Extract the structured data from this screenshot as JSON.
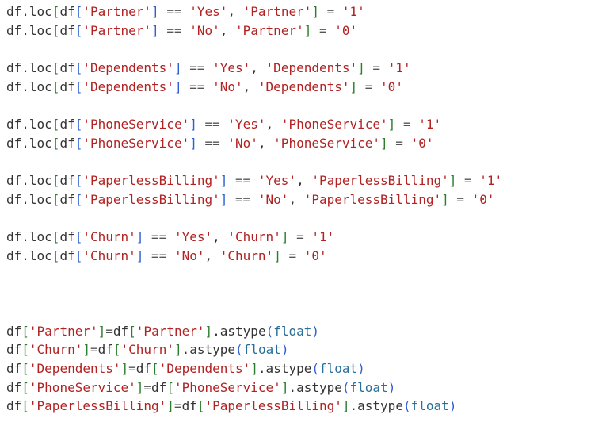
{
  "code": {
    "lines": [
      [
        {
          "t": "df.loc",
          "c": "plain"
        },
        {
          "t": "[",
          "c": "br1"
        },
        {
          "t": "df",
          "c": "plain"
        },
        {
          "t": "[",
          "c": "br2"
        },
        {
          "t": "'Partner'",
          "c": "str"
        },
        {
          "t": "]",
          "c": "br2"
        },
        {
          "t": " == ",
          "c": "op"
        },
        {
          "t": "'Yes'",
          "c": "str"
        },
        {
          "t": ", ",
          "c": "plain"
        },
        {
          "t": "'Partner'",
          "c": "str"
        },
        {
          "t": "]",
          "c": "br1"
        },
        {
          "t": " = ",
          "c": "op"
        },
        {
          "t": "'1'",
          "c": "str"
        }
      ],
      [
        {
          "t": "df.loc",
          "c": "plain"
        },
        {
          "t": "[",
          "c": "br1"
        },
        {
          "t": "df",
          "c": "plain"
        },
        {
          "t": "[",
          "c": "br2"
        },
        {
          "t": "'Partner'",
          "c": "str"
        },
        {
          "t": "]",
          "c": "br2"
        },
        {
          "t": " == ",
          "c": "op"
        },
        {
          "t": "'No'",
          "c": "str"
        },
        {
          "t": ", ",
          "c": "plain"
        },
        {
          "t": "'Partner'",
          "c": "str"
        },
        {
          "t": "]",
          "c": "br1"
        },
        {
          "t": " = ",
          "c": "op"
        },
        {
          "t": "'0'",
          "c": "str"
        }
      ],
      [],
      [
        {
          "t": "df.loc",
          "c": "plain"
        },
        {
          "t": "[",
          "c": "br1"
        },
        {
          "t": "df",
          "c": "plain"
        },
        {
          "t": "[",
          "c": "br2"
        },
        {
          "t": "'Dependents'",
          "c": "str"
        },
        {
          "t": "]",
          "c": "br2"
        },
        {
          "t": " == ",
          "c": "op"
        },
        {
          "t": "'Yes'",
          "c": "str"
        },
        {
          "t": ", ",
          "c": "plain"
        },
        {
          "t": "'Dependents'",
          "c": "str"
        },
        {
          "t": "]",
          "c": "br1"
        },
        {
          "t": " = ",
          "c": "op"
        },
        {
          "t": "'1'",
          "c": "str"
        }
      ],
      [
        {
          "t": "df.loc",
          "c": "plain"
        },
        {
          "t": "[",
          "c": "br1"
        },
        {
          "t": "df",
          "c": "plain"
        },
        {
          "t": "[",
          "c": "br2"
        },
        {
          "t": "'Dependents'",
          "c": "str"
        },
        {
          "t": "]",
          "c": "br2"
        },
        {
          "t": " == ",
          "c": "op"
        },
        {
          "t": "'No'",
          "c": "str"
        },
        {
          "t": ", ",
          "c": "plain"
        },
        {
          "t": "'Dependents'",
          "c": "str"
        },
        {
          "t": "]",
          "c": "br1"
        },
        {
          "t": " = ",
          "c": "op"
        },
        {
          "t": "'0'",
          "c": "str"
        }
      ],
      [],
      [
        {
          "t": "df.loc",
          "c": "plain"
        },
        {
          "t": "[",
          "c": "br1"
        },
        {
          "t": "df",
          "c": "plain"
        },
        {
          "t": "[",
          "c": "br2"
        },
        {
          "t": "'PhoneService'",
          "c": "str"
        },
        {
          "t": "]",
          "c": "br2"
        },
        {
          "t": " == ",
          "c": "op"
        },
        {
          "t": "'Yes'",
          "c": "str"
        },
        {
          "t": ", ",
          "c": "plain"
        },
        {
          "t": "'PhoneService'",
          "c": "str"
        },
        {
          "t": "]",
          "c": "br1"
        },
        {
          "t": " = ",
          "c": "op"
        },
        {
          "t": "'1'",
          "c": "str"
        }
      ],
      [
        {
          "t": "df.loc",
          "c": "plain"
        },
        {
          "t": "[",
          "c": "br1"
        },
        {
          "t": "df",
          "c": "plain"
        },
        {
          "t": "[",
          "c": "br2"
        },
        {
          "t": "'PhoneService'",
          "c": "str"
        },
        {
          "t": "]",
          "c": "br2"
        },
        {
          "t": " == ",
          "c": "op"
        },
        {
          "t": "'No'",
          "c": "str"
        },
        {
          "t": ", ",
          "c": "plain"
        },
        {
          "t": "'PhoneService'",
          "c": "str"
        },
        {
          "t": "]",
          "c": "br1"
        },
        {
          "t": " = ",
          "c": "op"
        },
        {
          "t": "'0'",
          "c": "str"
        }
      ],
      [],
      [
        {
          "t": "df.loc",
          "c": "plain"
        },
        {
          "t": "[",
          "c": "br1"
        },
        {
          "t": "df",
          "c": "plain"
        },
        {
          "t": "[",
          "c": "br2"
        },
        {
          "t": "'PaperlessBilling'",
          "c": "str"
        },
        {
          "t": "]",
          "c": "br2"
        },
        {
          "t": " == ",
          "c": "op"
        },
        {
          "t": "'Yes'",
          "c": "str"
        },
        {
          "t": ", ",
          "c": "plain"
        },
        {
          "t": "'PaperlessBilling'",
          "c": "str"
        },
        {
          "t": "]",
          "c": "br1"
        },
        {
          "t": " = ",
          "c": "op"
        },
        {
          "t": "'1'",
          "c": "str"
        }
      ],
      [
        {
          "t": "df.loc",
          "c": "plain"
        },
        {
          "t": "[",
          "c": "br1"
        },
        {
          "t": "df",
          "c": "plain"
        },
        {
          "t": "[",
          "c": "br2"
        },
        {
          "t": "'PaperlessBilling'",
          "c": "str"
        },
        {
          "t": "]",
          "c": "br2"
        },
        {
          "t": " == ",
          "c": "op"
        },
        {
          "t": "'No'",
          "c": "str"
        },
        {
          "t": ", ",
          "c": "plain"
        },
        {
          "t": "'PaperlessBilling'",
          "c": "str"
        },
        {
          "t": "]",
          "c": "br1"
        },
        {
          "t": " = ",
          "c": "op"
        },
        {
          "t": "'0'",
          "c": "str"
        }
      ],
      [],
      [
        {
          "t": "df.loc",
          "c": "plain"
        },
        {
          "t": "[",
          "c": "br1"
        },
        {
          "t": "df",
          "c": "plain"
        },
        {
          "t": "[",
          "c": "br2"
        },
        {
          "t": "'Churn'",
          "c": "str"
        },
        {
          "t": "]",
          "c": "br2"
        },
        {
          "t": " == ",
          "c": "op"
        },
        {
          "t": "'Yes'",
          "c": "str"
        },
        {
          "t": ", ",
          "c": "plain"
        },
        {
          "t": "'Churn'",
          "c": "str"
        },
        {
          "t": "]",
          "c": "br1"
        },
        {
          "t": " = ",
          "c": "op"
        },
        {
          "t": "'1'",
          "c": "str"
        }
      ],
      [
        {
          "t": "df.loc",
          "c": "plain"
        },
        {
          "t": "[",
          "c": "br1"
        },
        {
          "t": "df",
          "c": "plain"
        },
        {
          "t": "[",
          "c": "br2"
        },
        {
          "t": "'Churn'",
          "c": "str"
        },
        {
          "t": "]",
          "c": "br2"
        },
        {
          "t": " == ",
          "c": "op"
        },
        {
          "t": "'No'",
          "c": "str"
        },
        {
          "t": ", ",
          "c": "plain"
        },
        {
          "t": "'Churn'",
          "c": "str"
        },
        {
          "t": "]",
          "c": "br1"
        },
        {
          "t": " = ",
          "c": "op"
        },
        {
          "t": "'0'",
          "c": "str"
        }
      ],
      [],
      [],
      [],
      [
        {
          "t": "df",
          "c": "plain"
        },
        {
          "t": "[",
          "c": "br1"
        },
        {
          "t": "'Partner'",
          "c": "str"
        },
        {
          "t": "]",
          "c": "br1"
        },
        {
          "t": "=",
          "c": "op"
        },
        {
          "t": "df",
          "c": "plain"
        },
        {
          "t": "[",
          "c": "br1"
        },
        {
          "t": "'Partner'",
          "c": "str"
        },
        {
          "t": "]",
          "c": "br1"
        },
        {
          "t": ".astype",
          "c": "plain"
        },
        {
          "t": "(",
          "c": "br2"
        },
        {
          "t": "float",
          "c": "kw"
        },
        {
          "t": ")",
          "c": "br2"
        }
      ],
      [
        {
          "t": "df",
          "c": "plain"
        },
        {
          "t": "[",
          "c": "br1"
        },
        {
          "t": "'Churn'",
          "c": "str"
        },
        {
          "t": "]",
          "c": "br1"
        },
        {
          "t": "=",
          "c": "op"
        },
        {
          "t": "df",
          "c": "plain"
        },
        {
          "t": "[",
          "c": "br1"
        },
        {
          "t": "'Churn'",
          "c": "str"
        },
        {
          "t": "]",
          "c": "br1"
        },
        {
          "t": ".astype",
          "c": "plain"
        },
        {
          "t": "(",
          "c": "br2"
        },
        {
          "t": "float",
          "c": "kw"
        },
        {
          "t": ")",
          "c": "br2"
        }
      ],
      [
        {
          "t": "df",
          "c": "plain"
        },
        {
          "t": "[",
          "c": "br1"
        },
        {
          "t": "'Dependents'",
          "c": "str"
        },
        {
          "t": "]",
          "c": "br1"
        },
        {
          "t": "=",
          "c": "op"
        },
        {
          "t": "df",
          "c": "plain"
        },
        {
          "t": "[",
          "c": "br1"
        },
        {
          "t": "'Dependents'",
          "c": "str"
        },
        {
          "t": "]",
          "c": "br1"
        },
        {
          "t": ".astype",
          "c": "plain"
        },
        {
          "t": "(",
          "c": "br2"
        },
        {
          "t": "float",
          "c": "kw"
        },
        {
          "t": ")",
          "c": "br2"
        }
      ],
      [
        {
          "t": "df",
          "c": "plain"
        },
        {
          "t": "[",
          "c": "br1"
        },
        {
          "t": "'PhoneService'",
          "c": "str"
        },
        {
          "t": "]",
          "c": "br1"
        },
        {
          "t": "=",
          "c": "op"
        },
        {
          "t": "df",
          "c": "plain"
        },
        {
          "t": "[",
          "c": "br1"
        },
        {
          "t": "'PhoneService'",
          "c": "str"
        },
        {
          "t": "]",
          "c": "br1"
        },
        {
          "t": ".astype",
          "c": "plain"
        },
        {
          "t": "(",
          "c": "br2"
        },
        {
          "t": "float",
          "c": "kw"
        },
        {
          "t": ")",
          "c": "br2"
        }
      ],
      [
        {
          "t": "df",
          "c": "plain"
        },
        {
          "t": "[",
          "c": "br1"
        },
        {
          "t": "'PaperlessBilling'",
          "c": "str"
        },
        {
          "t": "]",
          "c": "br1"
        },
        {
          "t": "=",
          "c": "op"
        },
        {
          "t": "df",
          "c": "plain"
        },
        {
          "t": "[",
          "c": "br1"
        },
        {
          "t": "'PaperlessBilling'",
          "c": "str"
        },
        {
          "t": "]",
          "c": "br1"
        },
        {
          "t": ".astype",
          "c": "plain"
        },
        {
          "t": "(",
          "c": "br2"
        },
        {
          "t": "float",
          "c": "kw"
        },
        {
          "t": ")",
          "c": "br2"
        }
      ]
    ]
  },
  "colors": {
    "string": "#b22222",
    "bracket_outer": "#2b7d2b",
    "bracket_inner": "#2f5fd0",
    "keyword": "#2a6f97",
    "text": "#333333",
    "background": "#ffffff"
  }
}
